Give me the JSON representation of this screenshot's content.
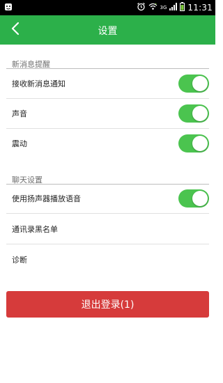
{
  "status_bar": {
    "time": "11:31",
    "network": "3G"
  },
  "header": {
    "title": "设置"
  },
  "sections": [
    {
      "title": "新消息提醒",
      "items": [
        {
          "label": "接收新消息通知",
          "toggle": true
        },
        {
          "label": "声音",
          "toggle": true
        },
        {
          "label": "震动",
          "toggle": true
        }
      ]
    },
    {
      "title": "聊天设置",
      "items": [
        {
          "label": "使用扬声器播放语音",
          "toggle": true
        },
        {
          "label": "通讯录黑名单"
        },
        {
          "label": "诊断"
        }
      ]
    }
  ],
  "logout": {
    "label": "退出登录(1)"
  },
  "colors": {
    "title_bar": "#2cb04a",
    "toggle_on": "#4bc44f",
    "logout": "#d63b3b"
  },
  "icons": [
    "notification-icon",
    "alarm-icon",
    "wifi-icon",
    "signal-icon",
    "battery-icon",
    "back-arrow-icon"
  ]
}
